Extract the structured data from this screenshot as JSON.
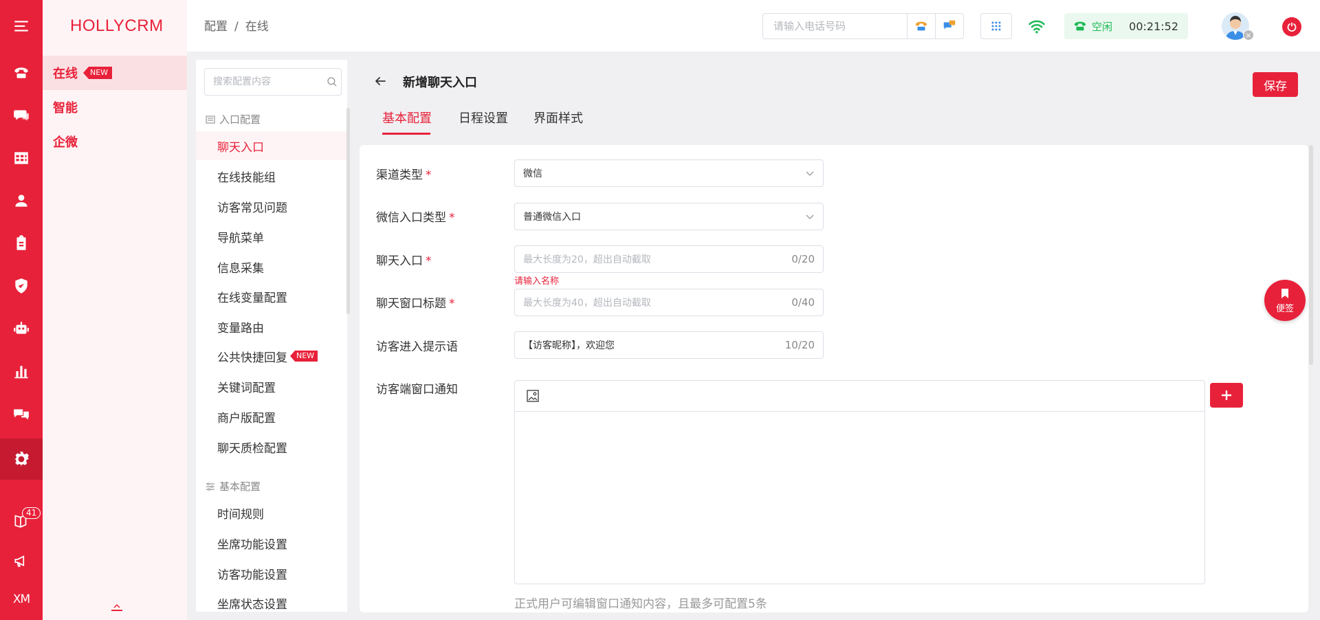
{
  "brand": "HOLLYCRM",
  "rail": {
    "badge_count": "41",
    "user_initials": "XM"
  },
  "subnav": {
    "items": [
      {
        "label": "在线",
        "badge": "NEW"
      },
      {
        "label": "智能"
      },
      {
        "label": "企微"
      }
    ]
  },
  "header": {
    "breadcrumb": [
      "配置",
      "在线"
    ],
    "breadcrumb_sep": "/",
    "phone_placeholder": "请输入电话号码",
    "status_label": "空闲",
    "status_time": "00:21:52"
  },
  "config_menu": {
    "search_placeholder": "搜索配置内容",
    "groups": [
      {
        "title": "入口配置",
        "items": [
          "聊天入口",
          "在线技能组",
          "访客常见问题",
          "导航菜单",
          "信息采集",
          "在线变量配置",
          "变量路由",
          "公共快捷回复",
          "关键词配置",
          "商户版配置",
          "聊天质检配置"
        ]
      },
      {
        "title": "基本配置",
        "items": [
          "时间规则",
          "坐席功能设置",
          "访客功能设置",
          "坐席状态设置"
        ]
      }
    ],
    "new_badge": "NEW"
  },
  "page": {
    "title": "新增聊天入口",
    "save_label": "保存",
    "tabs": [
      "基本配置",
      "日程设置",
      "界面样式"
    ]
  },
  "form": {
    "required_mark": "*",
    "channel_type": {
      "label": "渠道类型",
      "value": "微信"
    },
    "wechat_entry_type": {
      "label": "微信入口类型",
      "value": "普通微信入口"
    },
    "chat_entry": {
      "label": "聊天入口",
      "placeholder": "最大长度为20，超出自动截取",
      "count": "0/20",
      "error": "请输入名称"
    },
    "window_title": {
      "label": "聊天窗口标题",
      "placeholder": "最大长度为40，超出自动截取",
      "count": "0/40"
    },
    "visitor_prompt": {
      "label": "访客进入提示语",
      "value": "【访客昵称】，欢迎您",
      "count": "10/20"
    },
    "window_notice": {
      "label": "访客端窗口通知",
      "hint": "正式用户可编辑窗口通知内容，且最多可配置5条"
    }
  },
  "float_note": {
    "label": "便签"
  },
  "colors": {
    "primary": "#e8213a",
    "status_green": "#1db954"
  }
}
